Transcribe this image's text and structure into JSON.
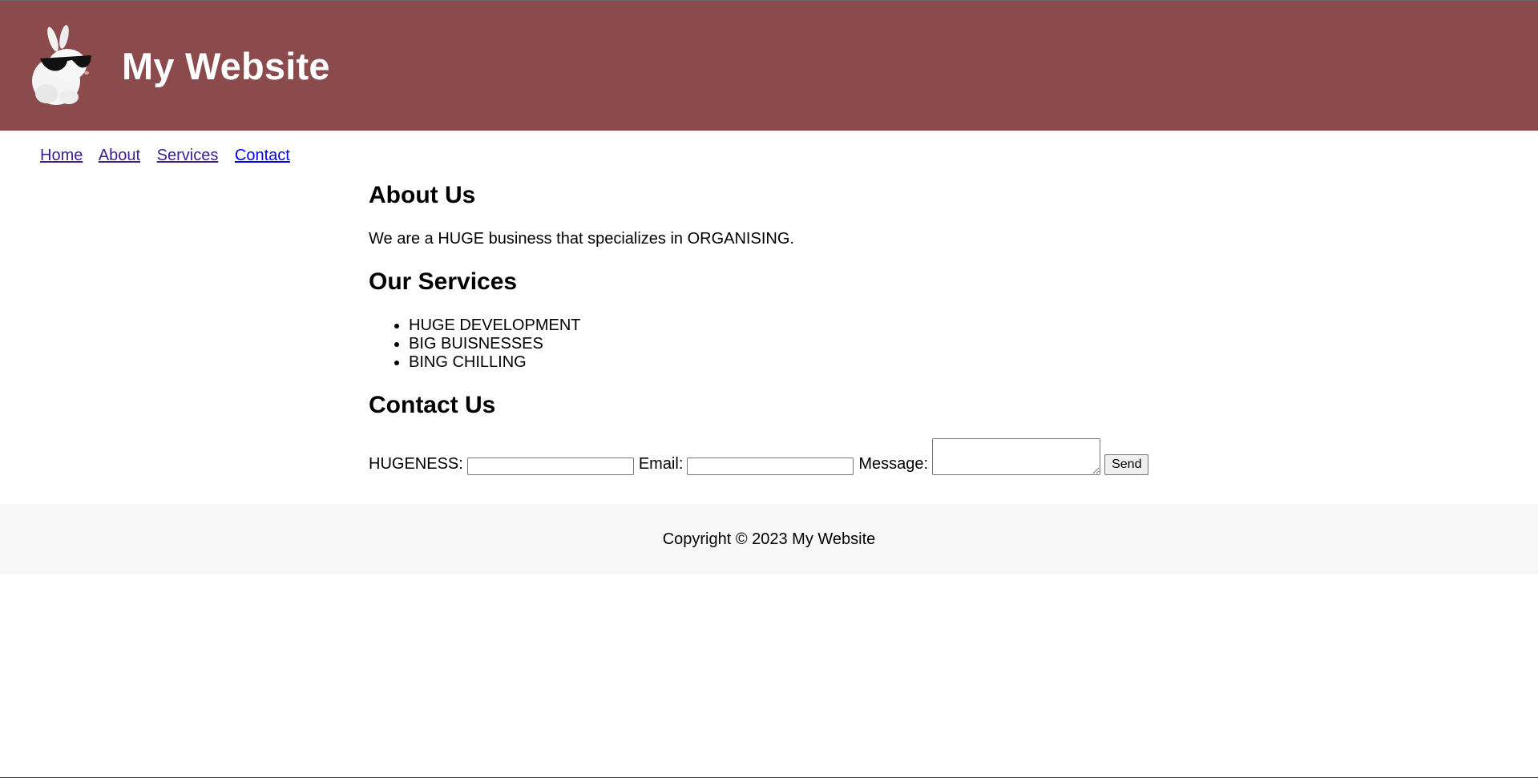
{
  "header": {
    "title": "My Website",
    "background_color": "#8b4b4d",
    "logo_icon": "bunny-with-sunglasses-logo"
  },
  "nav": {
    "items": [
      {
        "label": "Home"
      },
      {
        "label": "About"
      },
      {
        "label": "Services"
      },
      {
        "label": "Contact"
      }
    ]
  },
  "about": {
    "heading": "About Us",
    "text": "We are a HUGE business that specializes in ORGANISING."
  },
  "services": {
    "heading": "Our Services",
    "items": [
      "HUGE DEVELOPMENT",
      "BIG BUISNESSES",
      "BING CHILLING"
    ]
  },
  "contact": {
    "heading": "Contact Us",
    "hugeness_label": "HUGENESS:",
    "hugeness_value": "",
    "email_label": "Email:",
    "email_value": "",
    "message_label": "Message:",
    "message_value": "",
    "send_label": "Send"
  },
  "footer": {
    "copyright": "Copyright © 2023 My Website",
    "background_color": "#f8f8f8"
  }
}
